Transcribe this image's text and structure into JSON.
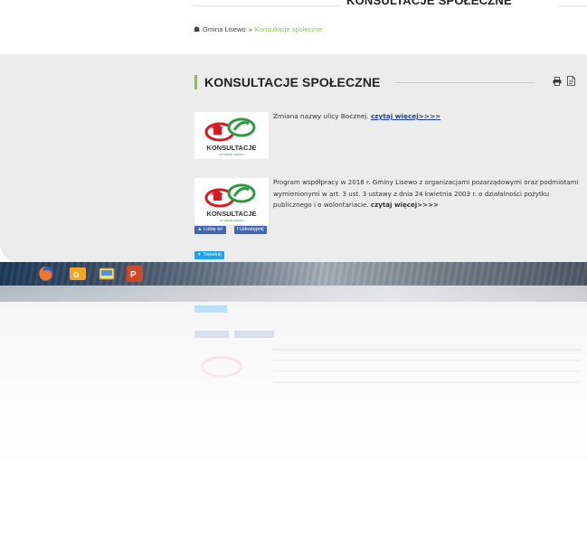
{
  "header": {
    "title": "KONSULTACJE SPOŁECZNE"
  },
  "breadcrumb": {
    "home": "Gmina Lisewo",
    "separator": "»",
    "current": "Konsultacje społeczne"
  },
  "section": {
    "title": "KONSULTACJE SPOŁECZNE"
  },
  "articles": [
    {
      "thumb_label": "KONSULTACJE",
      "thumb_sub": "W GMINIE LISEWO",
      "text": "Zmiana nazwy ulicy Bocznej.",
      "more": "czytaj więcej>>>>"
    },
    {
      "thumb_label": "KONSULTACJE",
      "thumb_sub": "W GMINIE LISEWO",
      "text": "Program współpracy w 2018 r. Gminy Lisewo z organizacjami pozarządowymi oraz podmiotami wymienionymi w art. 3 ust. 3 ustawy z dnia 24 kwietnia 2003 r. o działalności pożytku publicznego i o wolontariacie.",
      "more": "czytaj więcej>>>>"
    }
  ],
  "social": {
    "like": "Lubię to!",
    "share": "Udostępnij",
    "tweet": "Tweetnij"
  },
  "taskbar": {
    "icons": [
      "firefox-icon",
      "outlook-icon",
      "filezilla-icon",
      "powerpoint-icon"
    ]
  },
  "colors": {
    "accent": "#8cc63f",
    "link": "#1e3fa0",
    "facebook": "#4267b2",
    "twitter": "#1da1f2"
  }
}
